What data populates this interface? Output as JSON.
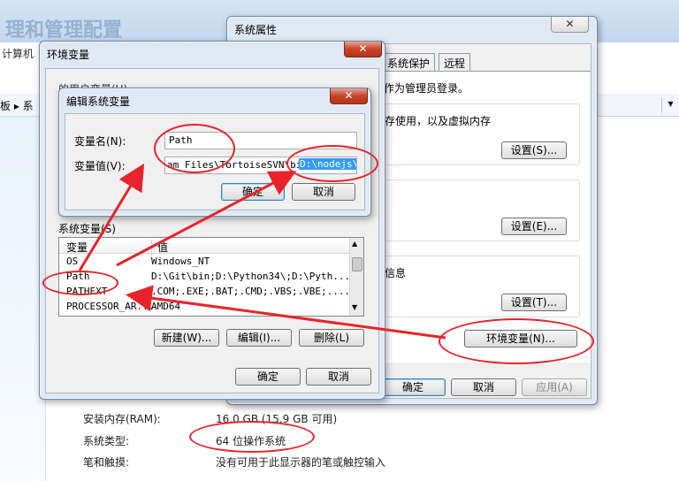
{
  "background": {
    "title": "理和管理配置",
    "crumb": "计算机",
    "address_label": "板 ▸ 系",
    "specs": [
      {
        "label": "安装内存(RAM):",
        "value": "16.0 GB (15.9 GB 可用)"
      },
      {
        "label": "系统类型:",
        "value": "64 位操作系统"
      },
      {
        "label": "笔和触摸:",
        "value": "没有可用于此显示器的笔或触控输入"
      }
    ]
  },
  "sysprops": {
    "title": "系统属性",
    "tabs": [
      "系统保护",
      "远程"
    ],
    "admin_note": "作为管理员登录。",
    "perf_text": "存使用，以及虚拟内存",
    "info_text": "信息",
    "settings_label_s": "设置(S)...",
    "settings_label_e": "设置(E)...",
    "settings_label_t": "设置(T)...",
    "env_button": "环境变量(N)...",
    "ok": "确定",
    "cancel": "取消",
    "apply": "应用(A)",
    "close": "✕"
  },
  "envvars": {
    "title": "环境变量",
    "user_section": "的用户变量(U)",
    "system_section": "系统变量(S)",
    "col_var": "变量",
    "col_val": "值",
    "rows": [
      {
        "name": "OS",
        "value": "Windows_NT"
      },
      {
        "name": "Path",
        "value": "D:\\Git\\bin;D:\\Python34\\;D:\\Pyth..."
      },
      {
        "name": "PATHEXT",
        "value": ".COM;.EXE;.BAT;.CMD;.VBS;.VBE;...."
      },
      {
        "name": "PROCESSOR_AR...",
        "value": "AMD64"
      }
    ],
    "new": "新建(W)...",
    "edit": "编辑(I)...",
    "delete": "删除(L)",
    "ok": "确定",
    "cancel": "取消",
    "close": "✕"
  },
  "editvar": {
    "title": "编辑系统变量",
    "name_label": "变量名(N):",
    "name_value": "Path",
    "value_label": "变量值(V):",
    "value_prefix": "am Files\\TortoiseSVN\\bin;",
    "value_selected": "D:\\nodejs\\",
    "ok": "确定",
    "cancel": "取消",
    "close": "✕"
  },
  "colors": {
    "annotation": "#e8232b",
    "selection": "#3399ff"
  }
}
